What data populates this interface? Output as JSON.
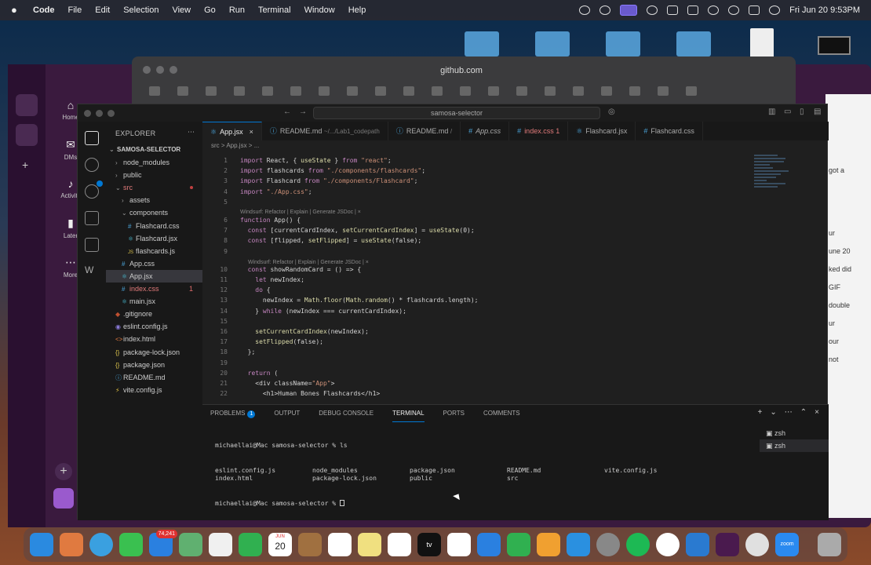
{
  "menubar": {
    "app": "Code",
    "items": [
      "File",
      "Edit",
      "Selection",
      "View",
      "Go",
      "Run",
      "Terminal",
      "Window",
      "Help"
    ],
    "datetime": "Fri Jun 20  9:53PM"
  },
  "browser": {
    "url": "github.com"
  },
  "slack": {
    "nav": [
      "Home",
      "DMs",
      "Activity",
      "Later",
      "More"
    ],
    "right_snippets": [
      "got a",
      "ur",
      "une 20",
      "ked did",
      "GIF",
      "double",
      "ur",
      "our",
      "not"
    ]
  },
  "vscode": {
    "search": "samosa-selector",
    "explorer_title": "EXPLORER",
    "project": "SAMOSA-SELECTOR",
    "tree": [
      {
        "name": "node_modules",
        "depth": 1,
        "type": "folder"
      },
      {
        "name": "public",
        "depth": 1,
        "type": "folder"
      },
      {
        "name": "src",
        "depth": 1,
        "type": "folder-open",
        "red": true
      },
      {
        "name": "assets",
        "depth": 2,
        "type": "folder"
      },
      {
        "name": "components",
        "depth": 2,
        "type": "folder-open"
      },
      {
        "name": "Flashcard.css",
        "depth": 3,
        "type": "css"
      },
      {
        "name": "Flashcard.jsx",
        "depth": 3,
        "type": "jsx"
      },
      {
        "name": "flashcards.js",
        "depth": 3,
        "type": "js"
      },
      {
        "name": "App.css",
        "depth": 2,
        "type": "css"
      },
      {
        "name": "App.jsx",
        "depth": 2,
        "type": "jsx",
        "selected": true
      },
      {
        "name": "index.css",
        "depth": 2,
        "type": "css",
        "red": true,
        "badge": "1"
      },
      {
        "name": "main.jsx",
        "depth": 2,
        "type": "jsx"
      },
      {
        "name": ".gitignore",
        "depth": 1,
        "type": "file"
      },
      {
        "name": "eslint.config.js",
        "depth": 1,
        "type": "js"
      },
      {
        "name": "index.html",
        "depth": 1,
        "type": "html"
      },
      {
        "name": "package-lock.json",
        "depth": 1,
        "type": "json"
      },
      {
        "name": "package.json",
        "depth": 1,
        "type": "json"
      },
      {
        "name": "README.md",
        "depth": 1,
        "type": "md"
      },
      {
        "name": "vite.config.js",
        "depth": 1,
        "type": "js"
      }
    ],
    "tabs": [
      {
        "label": "App.jsx",
        "active": true,
        "close": "×"
      },
      {
        "label": "README.md",
        "sub": "~/.../Lab1_codepath"
      },
      {
        "label": "README.md",
        "sub": "/"
      },
      {
        "label": "App.css"
      },
      {
        "label": "index.css 1",
        "red": true
      },
      {
        "label": "Flashcard.jsx"
      },
      {
        "label": "Flashcard.css"
      }
    ],
    "breadcrumb": "src > App.jsx > ...",
    "hint1": "Windsurf: Refactor | Explain | Generate JSDoc | ×",
    "hint2": "Windsurf: Refactor | Explain | Generate JSDoc | ×",
    "code": [
      {
        "n": "1",
        "t": "import React, { useState } from \"react\";"
      },
      {
        "n": "2",
        "t": "import flashcards from \"./components/flashcards\";"
      },
      {
        "n": "3",
        "t": "import Flashcard from \"./components/Flashcard\";"
      },
      {
        "n": "4",
        "t": "import \"./App.css\";"
      },
      {
        "n": "5",
        "t": ""
      },
      {
        "n": "6",
        "t": "function App() {"
      },
      {
        "n": "7",
        "t": "  const [currentCardIndex, setCurrentCardIndex] = useState(0);"
      },
      {
        "n": "8",
        "t": "  const [flipped, setFlipped] = useState(false);"
      },
      {
        "n": "9",
        "t": ""
      },
      {
        "n": "10",
        "t": "  const showRandomCard = () => {"
      },
      {
        "n": "11",
        "t": "    let newIndex;"
      },
      {
        "n": "12",
        "t": "    do {"
      },
      {
        "n": "13",
        "t": "      newIndex = Math.floor(Math.random() * flashcards.length);"
      },
      {
        "n": "14",
        "t": "    } while (newIndex === currentCardIndex);"
      },
      {
        "n": "15",
        "t": ""
      },
      {
        "n": "16",
        "t": "    setCurrentCardIndex(newIndex);"
      },
      {
        "n": "17",
        "t": "    setFlipped(false);"
      },
      {
        "n": "18",
        "t": "  };"
      },
      {
        "n": "19",
        "t": ""
      },
      {
        "n": "20",
        "t": "  return ("
      },
      {
        "n": "21",
        "t": "    <div className=\"App\">"
      },
      {
        "n": "22",
        "t": "      <h1>Human Bones Flashcards</h1>"
      }
    ],
    "panel_tabs": [
      "PROBLEMS",
      "OUTPUT",
      "DEBUG CONSOLE",
      "TERMINAL",
      "PORTS",
      "COMMENTS"
    ],
    "problems_count": "1",
    "terminal": {
      "line1": "michaellai@Mac samosa-selector % ls",
      "ls_col1": [
        "eslint.config.js",
        "index.html"
      ],
      "ls_col2": [
        "node_modules",
        "package-lock.json"
      ],
      "ls_col3": [
        "package.json",
        "public"
      ],
      "ls_col4": [
        "README.md",
        "src"
      ],
      "ls_col5": [
        "vite.config.js",
        ""
      ],
      "prompt": "michaellai@Mac samosa-selector % "
    },
    "terminal_list": [
      "zsh",
      "zsh"
    ]
  },
  "dock": {
    "mail_badge": "74,241",
    "calendar_month": "JUN",
    "calendar_day": "20"
  }
}
